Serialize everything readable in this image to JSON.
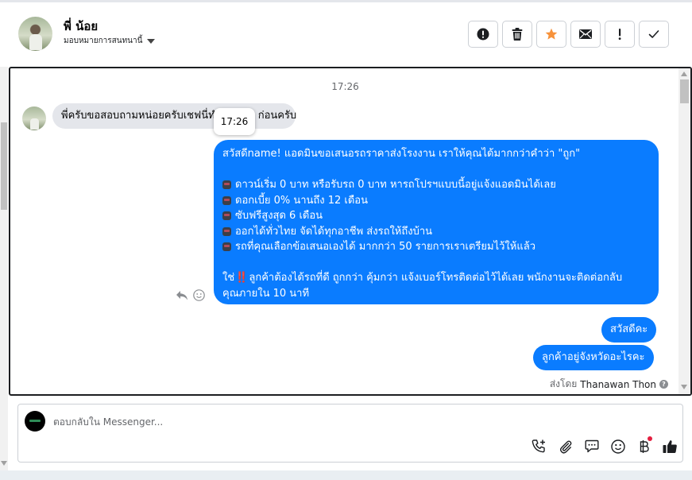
{
  "header": {
    "contact_name": "พี่ น้อย",
    "assign_label": "มอบหมายการสนทนานี้",
    "actions": [
      {
        "name": "report-button",
        "icon": "exclamation-circle-icon"
      },
      {
        "name": "delete-button",
        "icon": "trash-icon"
      },
      {
        "name": "star-button",
        "icon": "star-icon",
        "color": "#f7923b"
      },
      {
        "name": "mark-unread-button",
        "icon": "envelope-icon"
      },
      {
        "name": "follow-up-button",
        "icon": "exclamation-icon"
      },
      {
        "name": "mark-done-button",
        "icon": "checkmark-icon"
      }
    ]
  },
  "chat": {
    "timestamp": "17:26",
    "tooltip": "17:26",
    "incoming": {
      "text": "พี่ครับขอสอบถามหน่อยครับเชฟนี่ทำอย่างไร ก่อนครับ"
    },
    "outgoing_long": {
      "lines": [
        "สวัสดีname! แอดมินขอเสนอรถราคาส่งโรงงาน เราให้คุณได้มากกว่าคำว่า \"ถูก\"",
        "",
        "ดาวน์เริ่ม 0 บาท หรือรับรถ 0 บาท หารถโปรฯแบบนี้อยู่แจ้งแอดมินได้เลย",
        "ดอกเบี้ย 0% นานถึง 12 เดือน",
        "ซับฟรีสูงสุด 6 เดือน",
        "ออกได้ทั่วไทย จัดได้ทุกอาชีพ ส่งรถให้ถึงบ้าน",
        "รถที่คุณเลือกข้อเสนอเองได้ มากกว่า 50 รายการเราเตรียมไว้ให้แล้ว",
        "",
        "ลูกค้าต้องได้รถที่ดี ถูกกว่า คุ้มกว่า แจ้งเบอร์โทรติดต่อไว้ได้เลย พนักงานจะติดต่อกลับ",
        "คุณภายใน 10 นาที"
      ],
      "prefix_word": "ใช่",
      "excl": "‼️"
    },
    "outgoing_short": [
      "สวัสดีคะ",
      "ลูกค้าอยู่จังหวัดอะไรคะ"
    ],
    "sent_by_label": "ส่งโดย",
    "sent_by_name": "Thanawan Thon"
  },
  "composer": {
    "placeholder": "ตอบกลับใน Messenger..."
  },
  "colors": {
    "outgoing_bubble": "#0a7cff",
    "incoming_bubble": "#e4e6eb",
    "like_icon": "#1c1e21"
  }
}
